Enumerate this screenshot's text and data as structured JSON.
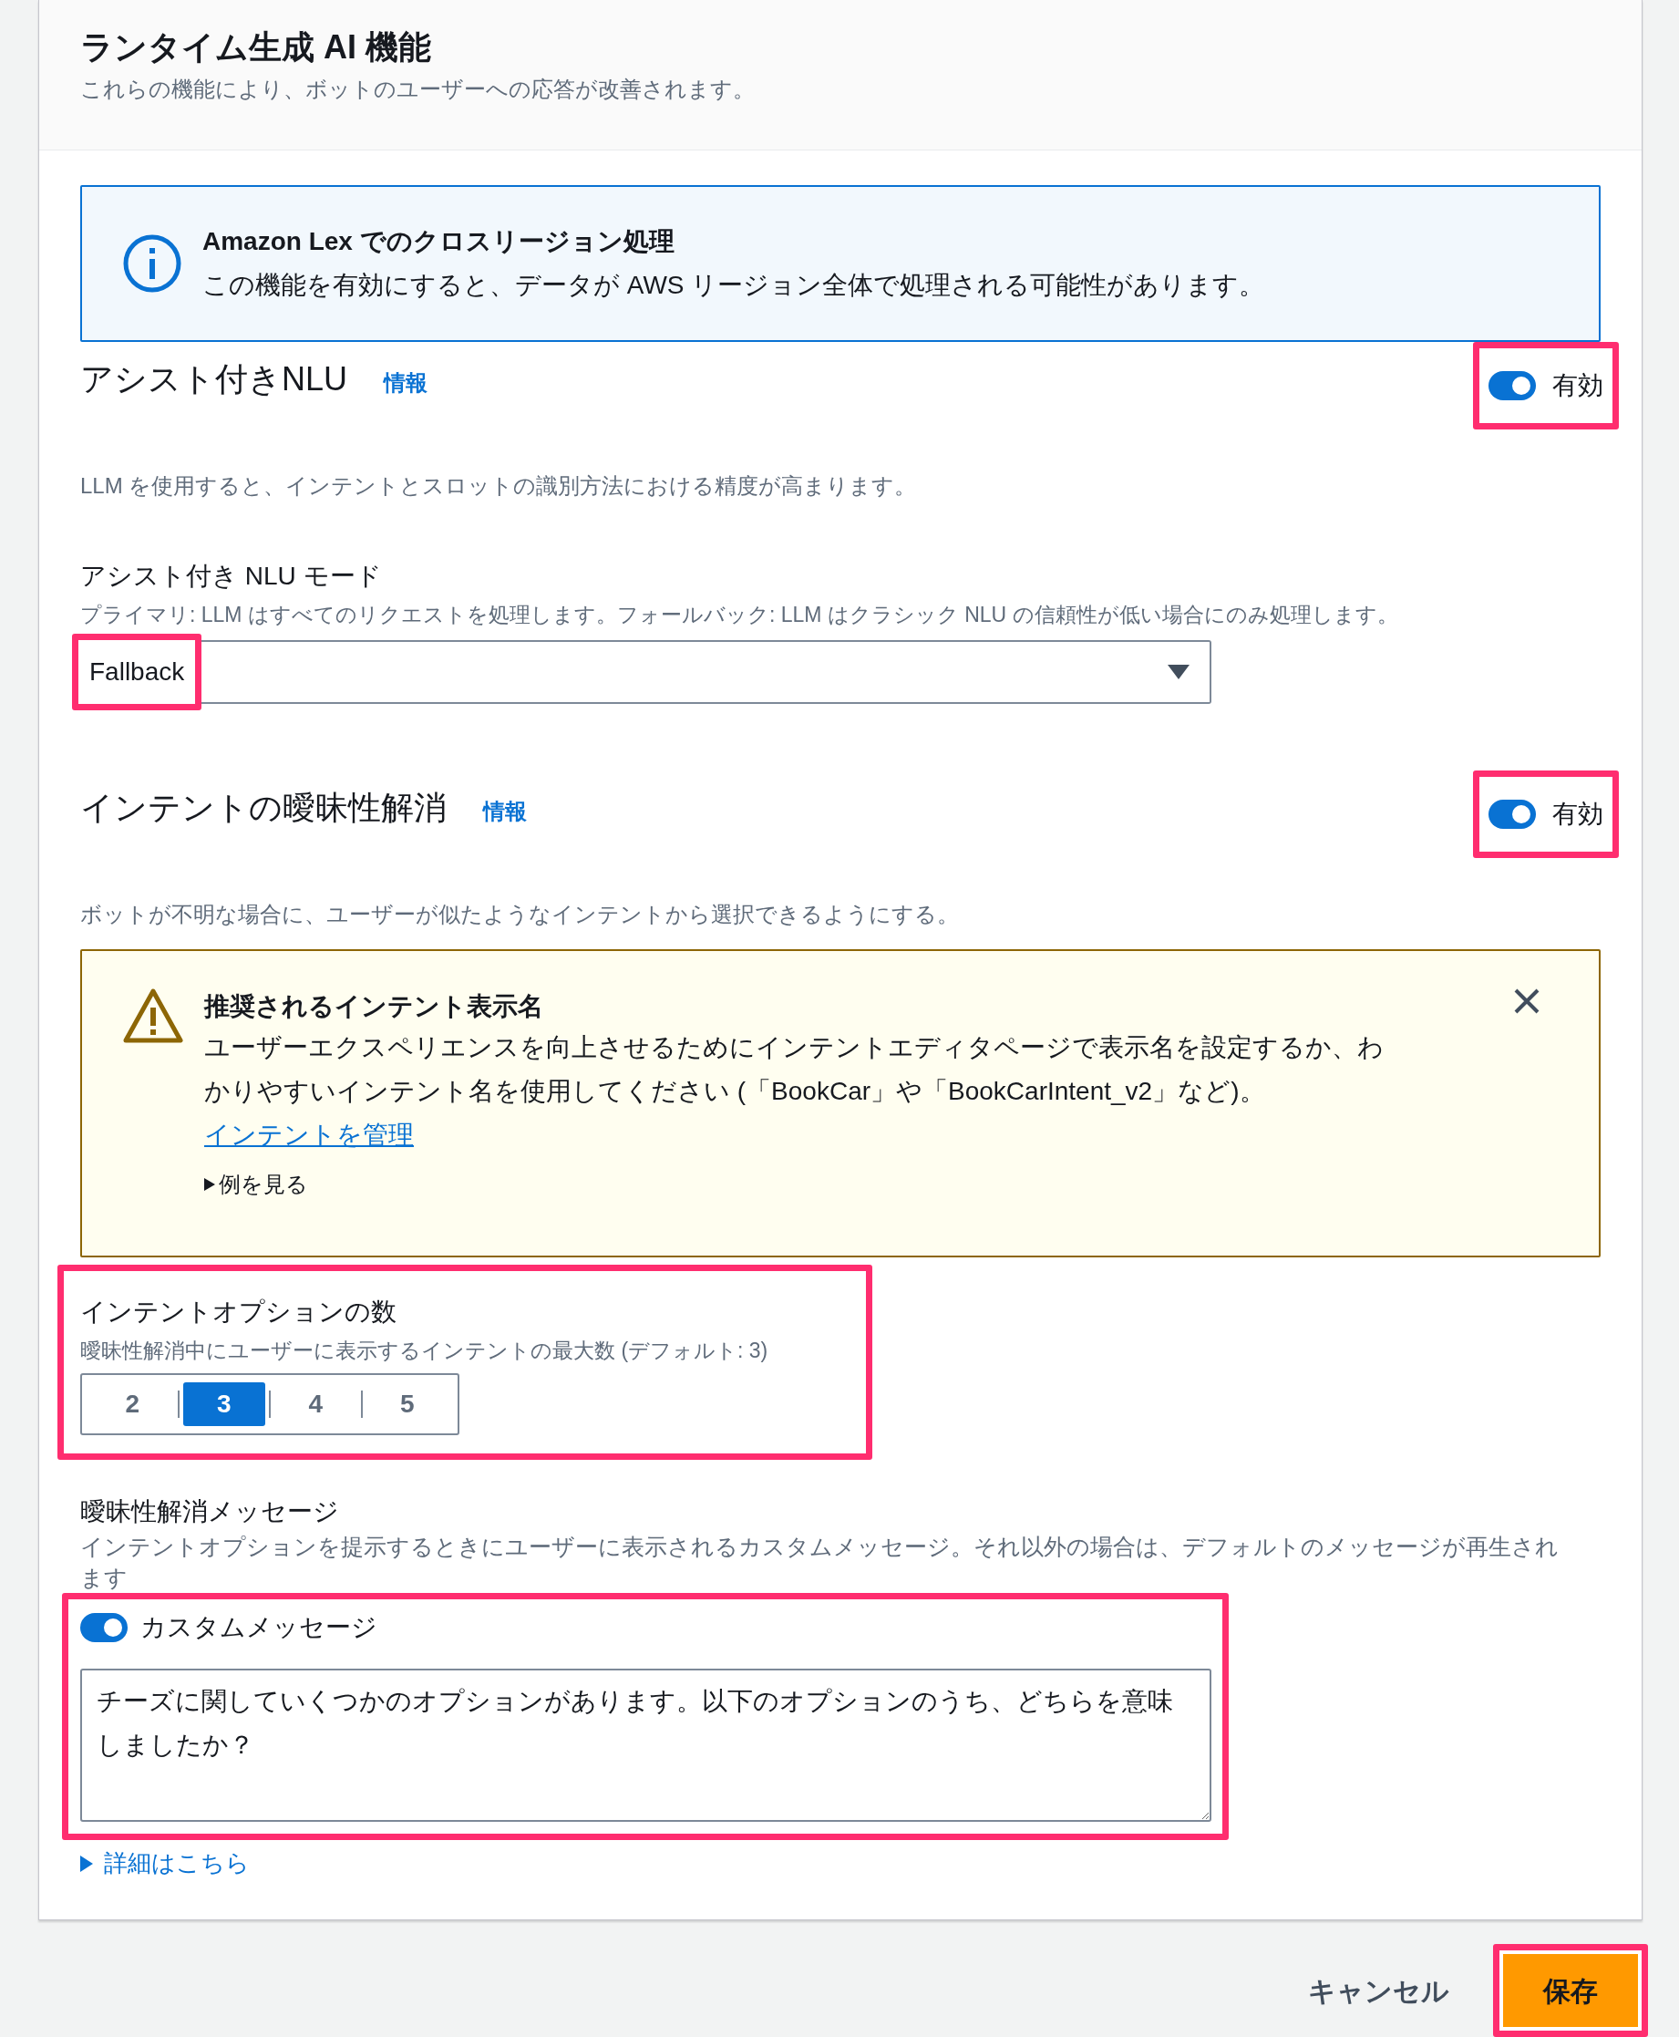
{
  "header": {
    "title": "ランタイム生成 AI 機能",
    "subtitle": "これらの機能により、ボットのユーザーへの応答が改善されます。"
  },
  "info_alert": {
    "title": "Amazon Lex でのクロスリージョン処理",
    "text": "この機能を有効にすると、データが AWS リージョン全体で処理される可能性があります。"
  },
  "assisted_nlu": {
    "title": "アシスト付きNLU",
    "info_link": "情報",
    "toggle": {
      "label": "有効",
      "on": true
    },
    "description": "LLM を使用すると、インテントとスロットの識別方法における精度が高まります。",
    "mode": {
      "label": "アシスト付き NLU モード",
      "hint": "プライマリ: LLM はすべてのリクエストを処理します。フォールバック: LLM はクラシック NLU の信頼性が低い場合にのみ処理します。",
      "value": "Fallback"
    }
  },
  "disambiguation": {
    "title": "インテントの曖昧性解消",
    "info_link": "情報",
    "toggle": {
      "label": "有効",
      "on": true
    },
    "description": "ボットが不明な場合に、ユーザーが似たようなインテントから選択できるようにする。",
    "warning": {
      "title": "推奨されるインテント表示名",
      "text": "ユーザーエクスペリエンスを向上させるためにインテントエディタページで表示名を設定するか、わかりやすいインテント名を使用してください (「BookCar」や「BookCarIntent_v2」など)。",
      "link": "インテントを管理",
      "expander": "例を見る"
    },
    "options": {
      "label": "インテントオプションの数",
      "hint": "曖昧性解消中にユーザーに表示するインテントの最大数 (デフォルト: 3)",
      "items": [
        {
          "label": "2",
          "selected": false
        },
        {
          "label": "3",
          "selected": true
        },
        {
          "label": "4",
          "selected": false
        },
        {
          "label": "5",
          "selected": false
        }
      ]
    },
    "message": {
      "label": "曖昧性解消メッセージ",
      "hint": "インテントオプションを提示するときにユーザーに表示されるカスタムメッセージ。それ以外の場合は、デフォルトのメッセージが再生されます",
      "custom_toggle": {
        "label": "カスタムメッセージ",
        "on": true
      },
      "value": "チーズに関していくつかのオプションがあります。以下のオプションのうち、どちらを意味しましたか？"
    },
    "learn_more": "詳細はこちら"
  },
  "footer": {
    "buttons": [
      {
        "label": "キャンセル",
        "kind": "secondary"
      },
      {
        "label": "保存",
        "kind": "primary"
      }
    ]
  }
}
